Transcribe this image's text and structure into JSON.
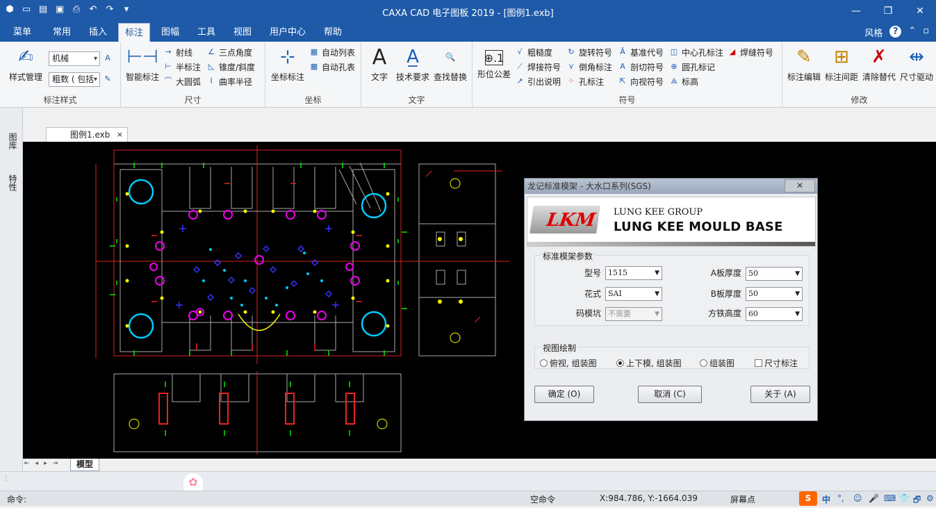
{
  "app": {
    "title": "CAXA CAD 电子图板 2019 - [图例1.exb]",
    "quick_access": [
      "app-logo-icon",
      "new-icon",
      "open-icon",
      "save-icon",
      "print-icon",
      "undo-icon",
      "redo-icon",
      "dropdown-icon"
    ]
  },
  "window_buttons": {
    "minimize": "—",
    "restore": "❐",
    "close": "✕"
  },
  "tabs": [
    "菜单",
    "常用",
    "插入",
    "标注",
    "图幅",
    "工具",
    "视图",
    "用户中心",
    "帮助"
  ],
  "active_tab": "标注",
  "tabbar_right": {
    "style": "风格",
    "help": "?"
  },
  "ribbon": {
    "group1": {
      "label": "标注样式",
      "big": "样式管理",
      "combo1": "机械",
      "combo2": "粗数 ( 包括"
    },
    "group2": {
      "label": "尺寸",
      "big": "智能标注",
      "items": [
        "射线",
        "半标注",
        "大圆弧",
        "三点角度",
        "锥度/斜度",
        "曲率半径"
      ]
    },
    "group3": {
      "label": "坐标",
      "big": "坐标标注",
      "items": [
        "自动列表",
        "自动孔表"
      ]
    },
    "group4": {
      "label": "文字",
      "bigs": [
        "文字",
        "技术要求",
        "查找替换"
      ]
    },
    "group5": {
      "label": "符号",
      "big": "形位公差",
      "items": [
        "粗糙度",
        "焊接符号",
        "引出说明",
        "旋转符号",
        "倒角标注",
        "孔标注",
        "基准代号",
        "剖切符号",
        "向视符号",
        "中心孔标注",
        "圆孔标记",
        "标高",
        "焊缝符号"
      ]
    },
    "group6": {
      "label": "修改",
      "bigs": [
        "标注编辑",
        "标注间距",
        "清除替代",
        "尺寸驱动"
      ]
    }
  },
  "document_tab": {
    "name": "图例1.exb",
    "close": "×"
  },
  "left_panel": [
    "图库",
    "特性"
  ],
  "bottom_tabs": {
    "nav": [
      "⇤",
      "◂",
      "▸",
      "⇥"
    ],
    "model": "模型"
  },
  "dialog": {
    "title": "龙记标准模架 - 大水口系列(SGS)",
    "close": "✕",
    "banner": {
      "logo": "LKM",
      "group": "LUNG KEE GROUP",
      "name": "LUNG KEE MOULD BASE"
    },
    "params_legend": "标准模架参数",
    "fields": [
      {
        "label": "型号",
        "value": "1515"
      },
      {
        "label": "花式",
        "value": "SAI"
      },
      {
        "label": "码模坑",
        "value": "不需要"
      },
      {
        "label": "A板厚度",
        "value": "50"
      },
      {
        "label": "B板厚度",
        "value": "50"
      },
      {
        "label": "方铁高度",
        "value": "60"
      }
    ],
    "view_legend": "视图绘制",
    "options": [
      "俯视, 组装图",
      "上下模, 组装图",
      "组装图",
      "尺寸标注"
    ],
    "selected_option": "上下模, 组装图",
    "buttons": [
      "确定 (O)",
      "取消 (C)",
      "关于 (A)"
    ]
  },
  "command": {
    "label": "命令:",
    "mode": "空命令",
    "coords": "X:984.786, Y:-1664.039",
    "snap": "屏幕点"
  },
  "tray": [
    "中",
    "°,",
    "☺",
    "🎤",
    "⌨",
    "👕",
    "🗗",
    "⚙"
  ]
}
